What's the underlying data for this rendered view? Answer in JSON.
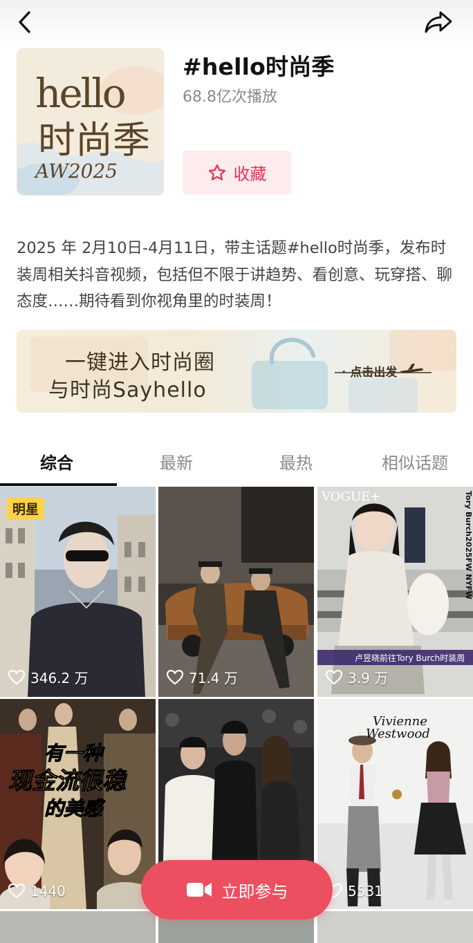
{
  "header": {
    "back_icon": "chevron-left-icon",
    "share_icon": "share-arrow-icon"
  },
  "topic": {
    "title": "#hello时尚季",
    "plays": "68.8亿次播放",
    "cover": {
      "line1": "hello",
      "line2": "时尚季",
      "line3": "AW2025"
    },
    "favorite_label": "收藏"
  },
  "description": "2025 年 2月10日-4月11日，带主话题#hello时尚季，发布时装周相关抖音视频，包括但不限于讲趋势、看创意、玩穿搭、聊态度……期待看到你视角里的时装周！",
  "banner": {
    "line1": "一键进入时尚圈",
    "line2": "与时尚Sayhello",
    "cta": "· 点击出发"
  },
  "tabs": [
    "综合",
    "最新",
    "最热",
    "相似话题"
  ],
  "active_tab": 0,
  "videos": [
    {
      "likes": "346.2 万",
      "badge": "明星"
    },
    {
      "likes": "71.4 万"
    },
    {
      "likes": "3.9 万",
      "caption": "卢昱晓前往Tory Burch时装周",
      "overlay": "VOGUE+",
      "side_text": "Tory Burch2025FW NYFW"
    },
    {
      "likes": "1440",
      "overlay_lines": [
        "有一种",
        "现金流很稳",
        "的美感"
      ]
    },
    {
      "likes": ""
    },
    {
      "likes": "5531",
      "overlay_lines": [
        "Vivienne",
        "Westwood"
      ]
    }
  ],
  "join_button": "立即参与",
  "colors": {
    "accent": "#e53557",
    "join": "#ec4f5f",
    "badge": "#fad24b"
  }
}
